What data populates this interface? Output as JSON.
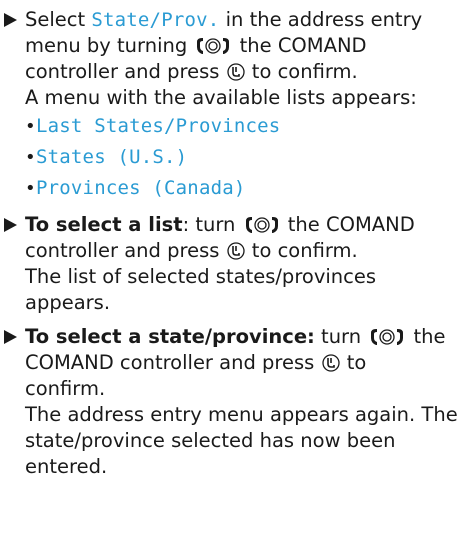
{
  "step1": {
    "pre": "Select ",
    "menu_item": "State/Prov.",
    "post1": " in the address entry",
    "line2": "menu by turning ",
    "line2_post": " the COMAND",
    "line3_pre": "controller and press ",
    "line3_post": " to confirm.",
    "result": "A menu with the available lists appears:",
    "options": [
      "Last States/Provinces",
      "States (U.S.)",
      "Provinces (Canada)"
    ]
  },
  "step2": {
    "bold": "To select a list",
    "after_bold": ": turn ",
    "line1_post": " the COMAND",
    "line2_pre": "controller and press ",
    "line2_post": " to confirm.",
    "result_line1": "The list of selected states/provinces",
    "result_line2": "appears."
  },
  "step3": {
    "bold": "To select a state/province:",
    "after_bold": " turn ",
    "line1_post": " the",
    "line2_pre": "COMAND controller and press ",
    "line2_post": " to",
    "line3": "confirm.",
    "result_line1": "The address entry menu appears again. The",
    "result_line2": "state/province selected has now been",
    "result_line3": "entered."
  },
  "icons": {
    "step_arrow": "triangle-right-icon",
    "turn_controller": "controller-turn-icon",
    "press_controller": "controller-press-icon"
  },
  "colors": {
    "menu_text": "#2a9bd3",
    "body_text": "#1a1a1a"
  }
}
